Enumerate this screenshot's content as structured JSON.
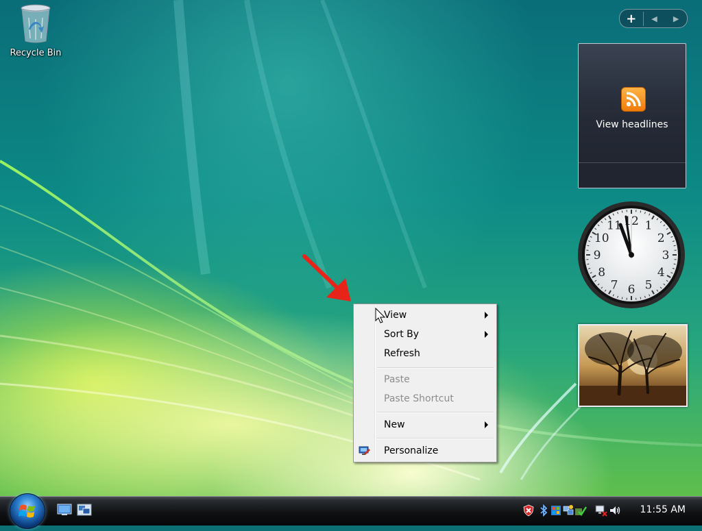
{
  "desktop": {
    "recycle_bin": {
      "label": "Recycle Bin",
      "icon": "recycle-bin-icon"
    }
  },
  "sidebar": {
    "add_button": "+",
    "prev_label": "◀",
    "next_label": "▶",
    "feed_gadget": {
      "title": "View headlines",
      "icon": "rss-icon",
      "accent": "#f59322"
    },
    "clock_gadget": {
      "numerals": [
        "12",
        "1",
        "2",
        "3",
        "4",
        "5",
        "6",
        "7",
        "8",
        "9",
        "10",
        "11"
      ],
      "time": "11:55"
    },
    "slideshow_gadget": {
      "subject": "trees-at-sunset-photo"
    }
  },
  "context_menu": {
    "items": [
      {
        "label": "View",
        "submenu": true,
        "disabled": false
      },
      {
        "label": "Sort By",
        "submenu": true,
        "disabled": false
      },
      {
        "label": "Refresh",
        "submenu": false,
        "disabled": false
      },
      {
        "label": "Paste",
        "submenu": false,
        "disabled": true
      },
      {
        "label": "Paste Shortcut",
        "submenu": false,
        "disabled": true
      },
      {
        "label": "New",
        "submenu": true,
        "disabled": false
      },
      {
        "label": "Personalize",
        "submenu": false,
        "disabled": false,
        "icon": "personalize-icon"
      }
    ]
  },
  "taskbar": {
    "start_icon": "windows-logo-icon",
    "quick_launch": [
      "show-desktop-icon",
      "switch-windows-icon"
    ],
    "tray_icons": [
      "security-alert-icon",
      "bluetooth-icon",
      "windows-update-icon",
      "network-activity-icon",
      "defender-icon",
      "network-disconnected-icon",
      "volume-icon"
    ],
    "clock": "11:55 AM"
  },
  "colors": {
    "arrow": "#e8231a",
    "menu_bg": "#f0f0f0",
    "taskbar": "#0d0f11"
  }
}
